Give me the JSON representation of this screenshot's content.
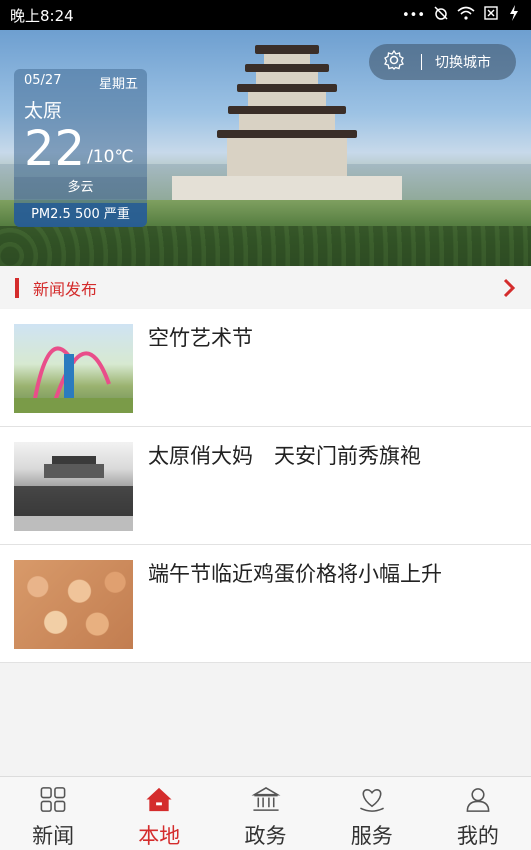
{
  "status_bar": {
    "time": "晚上8:24"
  },
  "weather": {
    "date": "05/27",
    "weekday": "星期五",
    "city": "太原",
    "temp_high": "22",
    "temp_low": "/10℃",
    "condition": "多云",
    "air_quality": "PM2.5 500 严重"
  },
  "city_switch": {
    "label": "切换城市",
    "icon": "gear-icon"
  },
  "section": {
    "title": "新闻发布",
    "accent_color": "#d42c2c"
  },
  "news": [
    {
      "headline": "空竹艺术节"
    },
    {
      "headline": "太原俏大妈　天安门前秀旗袍"
    },
    {
      "headline": "端午节临近鸡蛋价格将小幅上升"
    }
  ],
  "tabs": [
    {
      "label": "新闻",
      "icon": "grid-icon",
      "active": false
    },
    {
      "label": "本地",
      "icon": "home-icon",
      "active": true
    },
    {
      "label": "政务",
      "icon": "government-building-icon",
      "active": false
    },
    {
      "label": "服务",
      "icon": "heart-hands-icon",
      "active": false
    },
    {
      "label": "我的",
      "icon": "user-icon",
      "active": false
    }
  ]
}
